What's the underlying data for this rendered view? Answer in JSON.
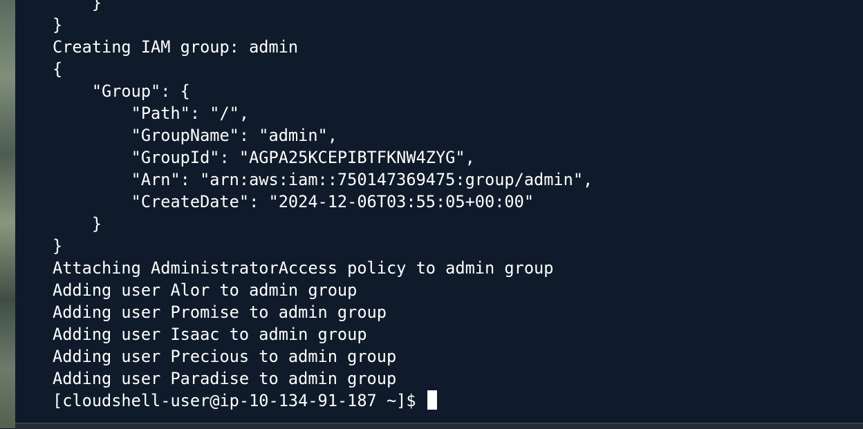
{
  "terminal": {
    "lines": [
      "    }",
      "}",
      "Creating IAM group: admin",
      "{",
      "    \"Group\": {",
      "        \"Path\": \"/\",",
      "        \"GroupName\": \"admin\",",
      "        \"GroupId\": \"AGPA25KCEPIBTFKNW4ZYG\",",
      "        \"Arn\": \"arn:aws:iam::750147369475:group/admin\",",
      "        \"CreateDate\": \"2024-12-06T03:55:05+00:00\"",
      "    }",
      "}",
      "Attaching AdministratorAccess policy to admin group",
      "Adding user Alor to admin group",
      "Adding user Promise to admin group",
      "Adding user Isaac to admin group",
      "Adding user Precious to admin group",
      "Adding user Paradise to admin group"
    ],
    "prompt": "[cloudshell-user@ip-10-134-91-187 ~]$ "
  }
}
